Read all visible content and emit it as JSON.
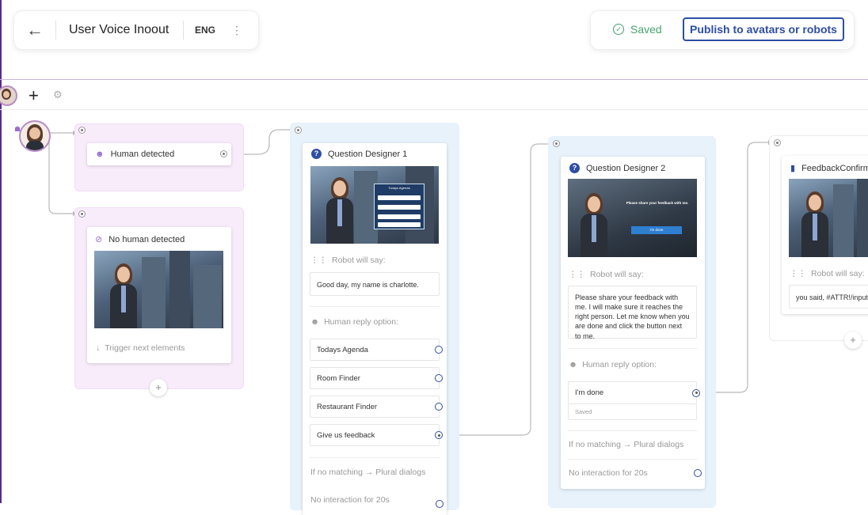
{
  "header": {
    "title": "User Voice Inoout",
    "lang": "ENG",
    "saved": "Saved",
    "publish": "Publish to avatars or robots"
  },
  "nodes": {
    "human_detected": {
      "title": "Human detected"
    },
    "no_human": {
      "title": "No human detected",
      "trigger": "Trigger next elements"
    },
    "qd1": {
      "title": "Question Designer 1",
      "robot_label": "Robot will say:",
      "robot_text": "Good day, my name is charlotte.",
      "reply_label": "Human reply option:",
      "options": [
        "Todays Agenda",
        "Room Finder",
        "Restaurant Finder",
        "Give us feedback"
      ],
      "no_match": "If no matching → Plural dialogs",
      "no_interaction": "No interaction for 20s",
      "screen_header": "Todays Agenda",
      "screen_rows": [
        "Room Finder",
        "Restaurant Finder",
        "Give us feedback"
      ]
    },
    "qd2": {
      "title": "Question Designer 2",
      "robot_label": "Robot will say:",
      "robot_text": "Please share your feedback with me. I will make sure it reaches the right person. Let me know when you are done and click the button next to me.",
      "reply_label": "Human reply option:",
      "reply_value": "I'm done",
      "reply_status": "Saved",
      "no_match": "If no matching → Plural dialogs",
      "no_interaction": "No interaction for 20s",
      "screen_text": "Please share your feedback with me.",
      "screen_button": "I'm done"
    },
    "fc": {
      "title": "FeedbackConfirm",
      "robot_label": "Robot will say:",
      "robot_text": "you said, #ATTR!/input"
    }
  },
  "icons": {
    "back": "arrow-left-icon",
    "saved": "check-circle-icon",
    "add": "plus-icon",
    "settings": "gear-icon",
    "question": "question-circle-icon",
    "waveform": "waveform-icon",
    "person": "person-icon",
    "no_person": "person-slash-icon",
    "arrow_down": "arrow-down-icon"
  },
  "colors": {
    "accent": "#2d4ea3",
    "saved_green": "#47a36b",
    "pink_lane": "#f8ecfb",
    "blue_lane": "#e7f2fb",
    "avatar_ring": "#b98cc6"
  }
}
